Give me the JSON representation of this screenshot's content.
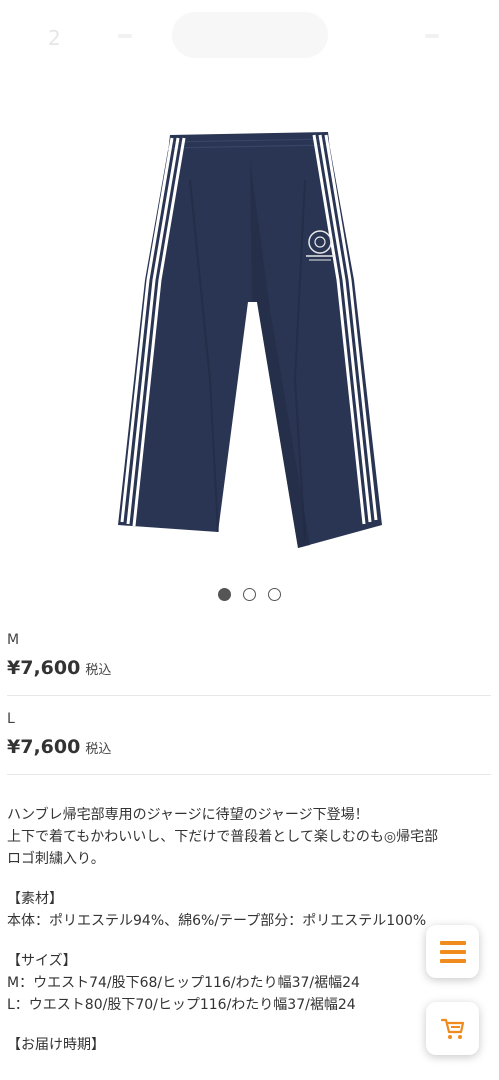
{
  "top_bar": {
    "page_indicator": "2"
  },
  "product": {
    "image": {
      "description_icon": "navy-track-pants-image",
      "colors": {
        "pants": "#2a3553",
        "stripe": "#ffffff"
      }
    },
    "carousel": {
      "count": 3,
      "active_index": 0
    },
    "variants": [
      {
        "name": "M",
        "price": "¥7,600",
        "tax_label": "税込"
      },
      {
        "name": "L",
        "price": "¥7,600",
        "tax_label": "税込"
      }
    ],
    "description": {
      "intro": [
        "ハンブレ帰宅部専用のジャージに待望のジャージ下登場！",
        "上下で着てもかわいいし、下だけで普段着として楽しむのも◎帰宅部",
        "ロゴ刺繍入り。"
      ],
      "material_heading": "【素材】",
      "material_text": "本体：ポリエステル94%、綿6%/テープ部分：ポリエステル100%",
      "size_heading": "【サイズ】",
      "size_m": "M：ウエスト74/股下68/ヒップ116/わたり幅37/裾幅24",
      "size_l": "L：ウエスト80/股下70/ヒップ116/わたり幅37/裾幅24",
      "delivery_heading": "【お届け時期】"
    }
  },
  "floating_buttons": {
    "menu_icon": "hamburger-menu-icon",
    "cart_icon": "shopping-cart-icon",
    "accent_color": "#f08c1e"
  }
}
